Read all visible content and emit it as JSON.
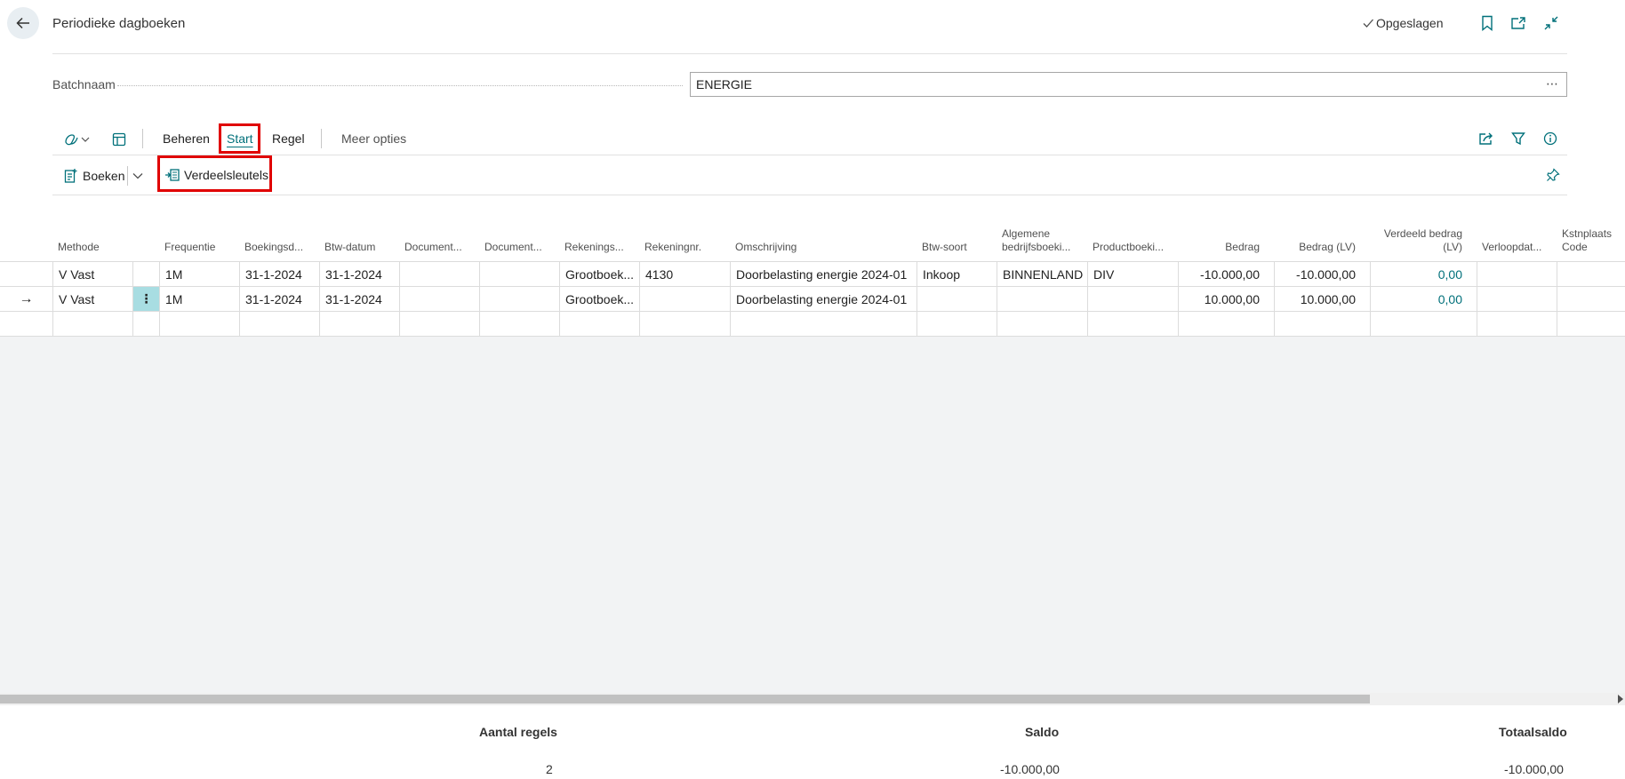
{
  "header": {
    "title": "Periodieke dagboeken",
    "saved_status": "Opgeslagen"
  },
  "batch": {
    "label": "Batchnaam",
    "value": "ENERGIE",
    "more": "⋯"
  },
  "tabs": {
    "beheren": "Beheren",
    "start": "Start",
    "regel": "Regel",
    "meer_opties": "Meer opties"
  },
  "actions": {
    "boeken": "Boeken",
    "verdeelsleutels": "Verdeelsleutels"
  },
  "grid": {
    "columns": {
      "methode": "Methode",
      "frequentie": "Frequentie",
      "boekingsdatum": "Boekingsd...",
      "btw_datum": "Btw-datum",
      "document1": "Document...",
      "document2": "Document...",
      "rekeningsoort": "Rekenings...",
      "rekeningnr": "Rekeningnr.",
      "omschrijving": "Omschrijving",
      "btw_soort": "Btw-soort",
      "alg_bedrijfsboeking_1": "Algemene",
      "alg_bedrijfsboeking_2": "bedrijfsboeki...",
      "productboeking": "Productboeki...",
      "bedrag": "Bedrag",
      "bedrag_lv": "Bedrag (LV)",
      "verdeeld_1": "Verdeeld bedrag",
      "verdeeld_2": "(LV)",
      "verloopdatum": "Verloopdat...",
      "kstnplaats_1": "Kstnplaats",
      "kstnplaats_2": "Code"
    },
    "rows": [
      {
        "arrow": "",
        "methode": "V  Vast",
        "frequentie": "1M",
        "boekingsdatum": "31-1-2024",
        "btw_datum": "31-1-2024",
        "rekeningsoort": "Grootboek...",
        "rekeningnr": "4130",
        "omschrijving": "Doorbelasting energie 2024-01",
        "btw_soort": "Inkoop",
        "alg_bedrijfsboeking": "BINNENLAND",
        "productboeking": "DIV",
        "bedrag": "-10.000,00",
        "bedrag_lv": "-10.000,00",
        "verdeeld": "0,00"
      },
      {
        "arrow": "→",
        "methode": "V  Vast",
        "row_menu": "⋮",
        "frequentie": "1M",
        "boekingsdatum": "31-1-2024",
        "btw_datum": "31-1-2024",
        "rekeningsoort": "Grootboek...",
        "rekeningnr": "",
        "omschrijving": "Doorbelasting energie 2024-01",
        "btw_soort": "",
        "alg_bedrijfsboeking": "",
        "productboeking": "",
        "bedrag": "10.000,00",
        "bedrag_lv": "10.000,00",
        "verdeeld": "0,00"
      }
    ]
  },
  "footer": {
    "aantal_regels_label": "Aantal regels",
    "aantal_regels_value": "2",
    "saldo_label": "Saldo",
    "saldo_value": "-10.000,00",
    "totaalsaldo_label": "Totaalsaldo",
    "totaalsaldo_value": "-10.000,00"
  },
  "colors": {
    "accent": "#00707a",
    "highlight": "#e00000",
    "selected_cell": "#a8dde2"
  },
  "icons": {
    "back": "arrow-left-icon",
    "saved": "checkmark-icon",
    "bookmark": "bookmark-icon",
    "open_new": "open-in-new-window-icon",
    "collapse": "collapse-icon",
    "copilot": "copilot-icon",
    "page_view": "page-layout-icon",
    "share": "share-icon",
    "filter": "filter-icon",
    "info": "info-icon",
    "pin": "pin-icon",
    "post": "post-document-icon",
    "allocation": "allocation-keys-icon"
  }
}
